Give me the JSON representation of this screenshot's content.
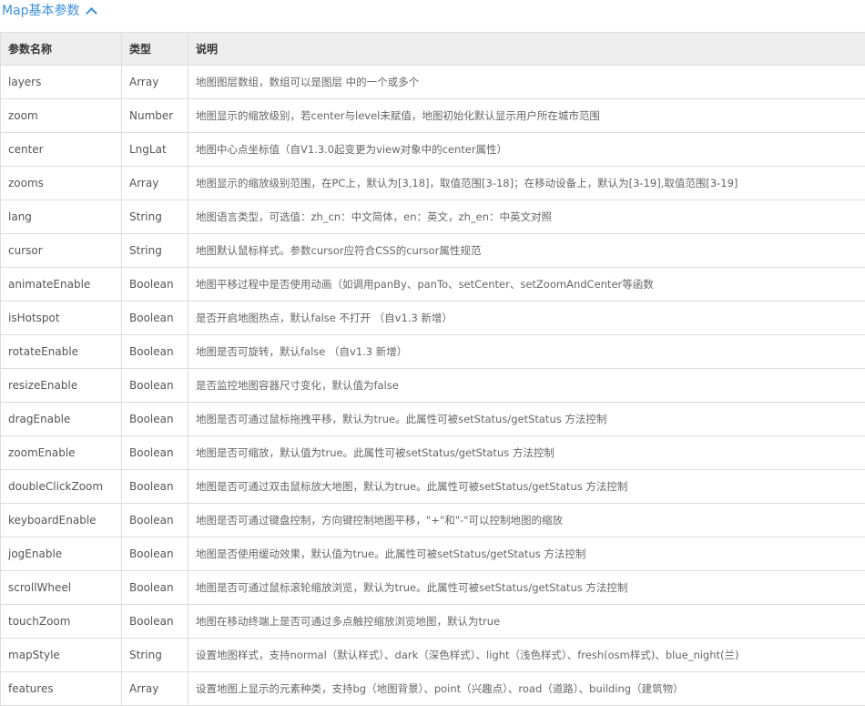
{
  "section": {
    "title": "Map基本参数",
    "toggle_icon": "chevron-up-icon"
  },
  "table": {
    "headers": [
      "参数名称",
      "类型",
      "说明"
    ],
    "rows": [
      {
        "name": "layers",
        "type": "Array",
        "desc": "地图图层数组，数组可以是图层 中的一个或多个"
      },
      {
        "name": "zoom",
        "type": "Number",
        "desc": "地图显示的缩放级别，若center与level未赋值，地图初始化默认显示用户所在城市范围"
      },
      {
        "name": "center",
        "type": "LngLat",
        "desc": "地图中心点坐标值（自V1.3.0起变更为view对象中的center属性）"
      },
      {
        "name": "zooms",
        "type": "Array",
        "desc": "地图显示的缩放级别范围，在PC上，默认为[3,18]，取值范围[3-18]；在移动设备上，默认为[3-19],取值范围[3-19]"
      },
      {
        "name": "lang",
        "type": "String",
        "desc": "地图语言类型，可选值：zh_cn：中文简体，en：英文，zh_en：中英文对照"
      },
      {
        "name": "cursor",
        "type": "String",
        "desc": "地图默认鼠标样式。参数cursor应符合CSS的cursor属性规范"
      },
      {
        "name": "animateEnable",
        "type": "Boolean",
        "desc": "地图平移过程中是否使用动画（如调用panBy、panTo、setCenter、setZoomAndCenter等函数"
      },
      {
        "name": "isHotspot",
        "type": "Boolean",
        "desc": "是否开启地图热点，默认false 不打开 （自v1.3 新增）"
      },
      {
        "name": "rotateEnable",
        "type": "Boolean",
        "desc": "地图是否可旋转，默认false （自v1.3 新增）"
      },
      {
        "name": "resizeEnable",
        "type": "Boolean",
        "desc": "是否监控地图容器尺寸变化，默认值为false"
      },
      {
        "name": "dragEnable",
        "type": "Boolean",
        "desc": "地图是否可通过鼠标拖拽平移，默认为true。此属性可被setStatus/getStatus 方法控制"
      },
      {
        "name": "zoomEnable",
        "type": "Boolean",
        "desc": "地图是否可缩放，默认值为true。此属性可被setStatus/getStatus 方法控制"
      },
      {
        "name": "doubleClickZoom",
        "type": "Boolean",
        "desc": "地图是否可通过双击鼠标放大地图，默认为true。此属性可被setStatus/getStatus 方法控制"
      },
      {
        "name": "keyboardEnable",
        "type": "Boolean",
        "desc": "地图是否可通过键盘控制，方向键控制地图平移，\"+\"和\"-\"可以控制地图的缩放"
      },
      {
        "name": "jogEnable",
        "type": "Boolean",
        "desc": "地图是否使用缓动效果，默认值为true。此属性可被setStatus/getStatus 方法控制"
      },
      {
        "name": "scrollWheel",
        "type": "Boolean",
        "desc": "地图是否可通过鼠标滚轮缩放浏览，默认为true。此属性可被setStatus/getStatus 方法控制"
      },
      {
        "name": "touchZoom",
        "type": "Boolean",
        "desc": "地图在移动终端上是否可通过多点触控缩放浏览地图，默认为true"
      },
      {
        "name": "mapStyle",
        "type": "String",
        "desc": "设置地图样式，支持normal（默认样式）、dark（深色样式）、light（浅色样式）、fresh(osm样式)、blue_night(兰)"
      },
      {
        "name": "features",
        "type": "Array",
        "desc": "设置地图上显示的元素种类，支持bg（地图背景）、point（兴趣点）、road（道路）、building（建筑物）"
      }
    ]
  },
  "colors": {
    "accent": "#3d8fd9",
    "header_bg": "#eeeeee",
    "border": "#dddddd"
  }
}
